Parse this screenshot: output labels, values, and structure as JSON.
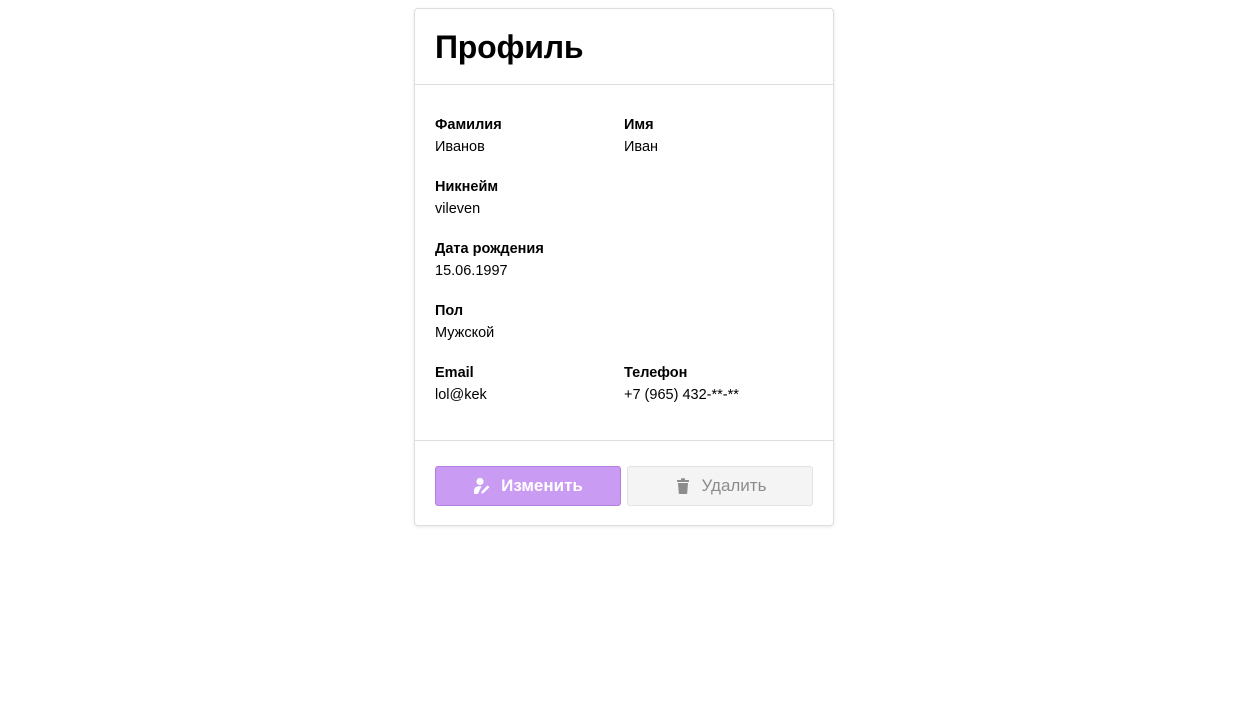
{
  "profile": {
    "title": "Профиль",
    "fields": {
      "last_name": {
        "label": "Фамилия",
        "value": "Иванов"
      },
      "first_name": {
        "label": "Имя",
        "value": "Иван"
      },
      "nickname": {
        "label": "Никнейм",
        "value": "vileven"
      },
      "birth_date": {
        "label": "Дата рождения",
        "value": "15.06.1997"
      },
      "gender": {
        "label": "Пол",
        "value": "Мужской"
      },
      "email": {
        "label": "Email",
        "value": "lol@kek"
      },
      "phone": {
        "label": "Телефон",
        "value": "+7 (965) 432-**-**"
      }
    },
    "actions": {
      "edit_label": "Изменить",
      "edit_icon": "user-edit-icon",
      "delete_label": "Удалить",
      "delete_icon": "trash-icon"
    }
  },
  "colors": {
    "edit_button_bg": "#c99bf2",
    "delete_button_bg": "#f4f4f4",
    "border": "#dedede"
  }
}
